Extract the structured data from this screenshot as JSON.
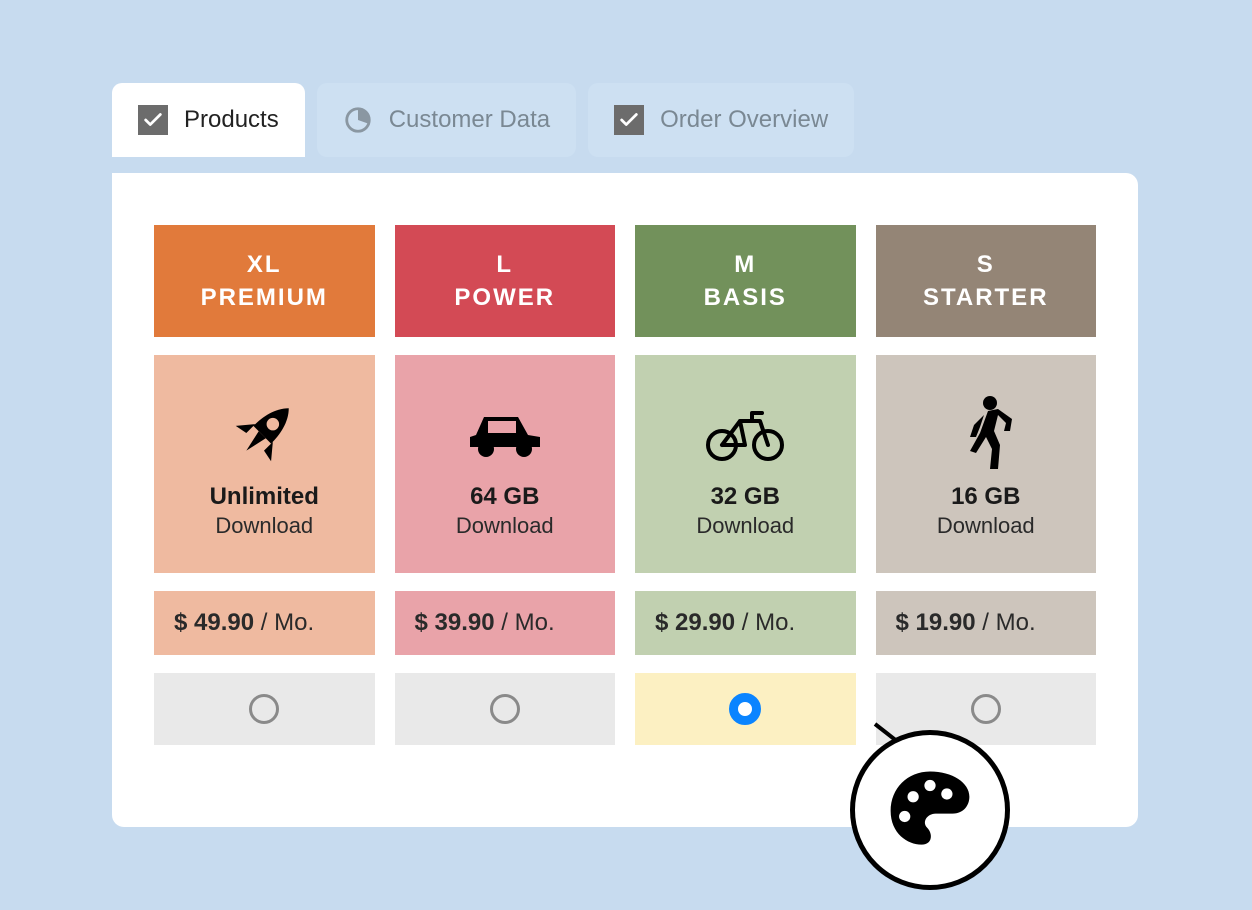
{
  "tabs": [
    {
      "label": "Products",
      "icon": "check",
      "active": true
    },
    {
      "label": "Customer Data",
      "icon": "pie",
      "active": false
    },
    {
      "label": "Order Overview",
      "icon": "check",
      "active": false
    }
  ],
  "plans": [
    {
      "size": "XL",
      "name": "PREMIUM",
      "icon": "rocket",
      "quota": "Unlimited",
      "quota_sub": "Download",
      "currency": "$",
      "price": "49.90",
      "per": "/ Mo.",
      "selected": false,
      "colors": {
        "header": "#e17a3b",
        "light": "#efbaa0"
      }
    },
    {
      "size": "L",
      "name": "POWER",
      "icon": "car",
      "quota": "64 GB",
      "quota_sub": "Download",
      "currency": "$",
      "price": "39.90",
      "per": "/ Mo.",
      "selected": false,
      "colors": {
        "header": "#d34a55",
        "light": "#e9a3a9"
      }
    },
    {
      "size": "M",
      "name": "BASIS",
      "icon": "bicycle",
      "quota": "32 GB",
      "quota_sub": "Download",
      "currency": "$",
      "price": "29.90",
      "per": "/ Mo.",
      "selected": true,
      "colors": {
        "header": "#72915b",
        "light": "#c1d0b0"
      }
    },
    {
      "size": "S",
      "name": "STARTER",
      "icon": "walker",
      "quota": "16 GB",
      "quota_sub": "Download",
      "currency": "$",
      "price": "19.90",
      "per": "/ Mo.",
      "selected": false,
      "colors": {
        "header": "#948576",
        "light": "#cdc5bc"
      }
    }
  ],
  "callout": {
    "icon": "palette"
  }
}
